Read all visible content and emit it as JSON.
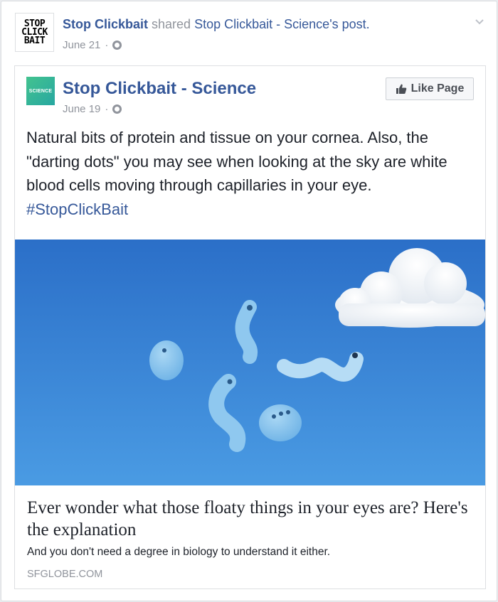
{
  "shared_post": {
    "avatar_logo_lines": [
      "STOP",
      "CLICK",
      "BAIT"
    ],
    "sharer_name": "Stop Clickbait",
    "action_text": "shared",
    "source_name": "Stop Clickbait - Science",
    "source_suffix": "'s post.",
    "date": "June 21",
    "separator": "·",
    "privacy_icon": "globe-icon",
    "menu_icon": "chevron-down-icon"
  },
  "original_post": {
    "logo_text": "SCIENCE",
    "page_name": "Stop Clickbait - Science",
    "date": "June 19",
    "separator": "·",
    "privacy_icon": "globe-icon",
    "like_button": {
      "icon": "thumbs-up-icon",
      "label": "Like Page"
    },
    "text": "Natural bits of protein and tissue on your cornea. Also, the \"darting dots\" you may see when looking at the sky are white blood cells moving through capillaries in your eye.",
    "hashtag": "#StopClickBait"
  },
  "link_preview": {
    "image_subject": "floaters-illustration",
    "title": "Ever wonder what those floaty things in your eyes are? Here's the explanation",
    "description": "And you don't need a degree in biology to understand it either.",
    "domain": "SFGLOBE.COM"
  },
  "colors": {
    "link_blue": "#365899",
    "meta_gray": "#90949c",
    "sky_top": "#2b6fc8",
    "sky_bottom": "#4a9be3"
  }
}
